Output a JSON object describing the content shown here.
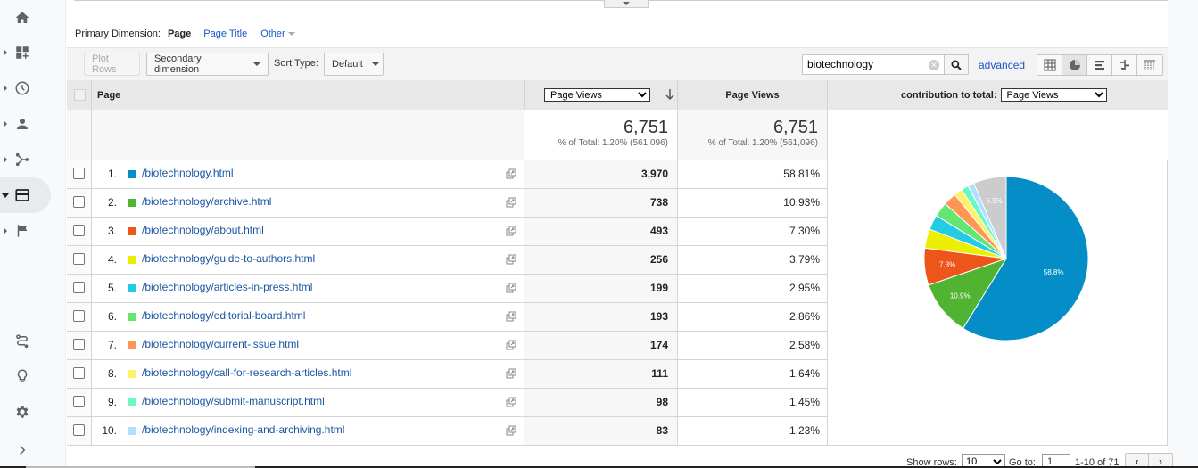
{
  "nav": {
    "items": [
      {
        "name": "home",
        "icon": "home-icon",
        "expandable": false,
        "active": false
      },
      {
        "name": "customization",
        "icon": "dashboard-add-icon",
        "expandable": true,
        "active": false
      },
      {
        "name": "realtime",
        "icon": "clock-icon",
        "expandable": true,
        "active": false
      },
      {
        "name": "audience",
        "icon": "person-icon",
        "expandable": true,
        "active": false
      },
      {
        "name": "acquisition",
        "icon": "acquisition-icon",
        "expandable": true,
        "active": false
      },
      {
        "name": "behavior",
        "icon": "behavior-icon",
        "expandable": true,
        "active": true
      },
      {
        "name": "conversions",
        "icon": "flag-icon",
        "expandable": true,
        "active": false
      }
    ],
    "bottom": [
      {
        "name": "attribution",
        "icon": "route-icon"
      },
      {
        "name": "discover",
        "icon": "lightbulb-icon"
      },
      {
        "name": "admin",
        "icon": "gear-icon"
      },
      {
        "name": "expand",
        "icon": "chevron-right-icon"
      }
    ]
  },
  "dimension": {
    "label": "Primary Dimension:",
    "current": "Page",
    "options": [
      "Page Title",
      "Other"
    ]
  },
  "toolbar": {
    "plot_rows": "Plot Rows",
    "secondary_dimension": "Secondary dimension",
    "sort_type_label": "Sort Type:",
    "sort_type_value": "Default",
    "search_value": "biotechnology",
    "advanced": "advanced",
    "views": [
      "table-view-icon",
      "pie-view-icon",
      "bar-view-icon",
      "comparison-view-icon",
      "pivot-view-icon"
    ],
    "active_view": "pie-view-icon"
  },
  "table": {
    "header": {
      "page": "Page",
      "metric_select": "Page Views",
      "metric2": "Page Views",
      "contribution_label": "contribution to total:",
      "contribution_select": "Page Views"
    },
    "totals": {
      "value1": "6,751",
      "sub1": "% of Total: 1.20% (561,096)",
      "value2": "6,751",
      "sub2": "% of Total: 1.20% (561,096)"
    },
    "rows": [
      {
        "rank": "1.",
        "page": "/biotechnology.html",
        "views": "3,970",
        "pct": "58.81%",
        "color": "#058dc7"
      },
      {
        "rank": "2.",
        "page": "/biotechnology/archive.html",
        "views": "738",
        "pct": "10.93%",
        "color": "#50b432"
      },
      {
        "rank": "3.",
        "page": "/biotechnology/about.html",
        "views": "493",
        "pct": "7.30%",
        "color": "#ed561b"
      },
      {
        "rank": "4.",
        "page": "/biotechnology/guide-to-authors.html",
        "views": "256",
        "pct": "3.79%",
        "color": "#edef00"
      },
      {
        "rank": "5.",
        "page": "/biotechnology/articles-in-press.html",
        "views": "199",
        "pct": "2.95%",
        "color": "#24cbe5"
      },
      {
        "rank": "6.",
        "page": "/biotechnology/editorial-board.html",
        "views": "193",
        "pct": "2.86%",
        "color": "#64e572"
      },
      {
        "rank": "7.",
        "page": "/biotechnology/current-issue.html",
        "views": "174",
        "pct": "2.58%",
        "color": "#ff9655"
      },
      {
        "rank": "8.",
        "page": "/biotechnology/call-for-research-articles.html",
        "views": "111",
        "pct": "1.64%",
        "color": "#fff263"
      },
      {
        "rank": "9.",
        "page": "/biotechnology/submit-manuscript.html",
        "views": "98",
        "pct": "1.45%",
        "color": "#6af9c4"
      },
      {
        "rank": "10.",
        "page": "/biotechnology/indexing-and-archiving.html",
        "views": "83",
        "pct": "1.23%",
        "color": "#b2deff"
      }
    ]
  },
  "chart_data": {
    "type": "pie",
    "title": "contribution to total: Page Views",
    "categories": [
      "/biotechnology.html",
      "/biotechnology/archive.html",
      "/biotechnology/about.html",
      "/biotechnology/guide-to-authors.html",
      "/biotechnology/articles-in-press.html",
      "/biotechnology/editorial-board.html",
      "/biotechnology/current-issue.html",
      "/biotechnology/call-for-research-articles.html",
      "/biotechnology/submit-manuscript.html",
      "/biotechnology/indexing-and-archiving.html",
      "Other"
    ],
    "values": [
      58.81,
      10.93,
      7.3,
      3.79,
      2.95,
      2.86,
      2.58,
      1.64,
      1.45,
      1.23,
      6.46
    ],
    "colors": [
      "#058dc7",
      "#50b432",
      "#ed561b",
      "#edef00",
      "#24cbe5",
      "#64e572",
      "#ff9655",
      "#fff263",
      "#6af9c4",
      "#b2deff",
      "#cccccc"
    ],
    "data_labels": [
      "58.8%",
      "10.9%",
      "7.3%",
      "",
      "",
      "",
      "",
      "",
      "",
      "",
      "6.5%"
    ]
  },
  "footer": {
    "show_rows_label": "Show rows:",
    "show_rows_value": "10",
    "goto_label": "Go to:",
    "goto_value": "1",
    "range": "1-10 of 71",
    "prev": "‹",
    "next": "›"
  }
}
